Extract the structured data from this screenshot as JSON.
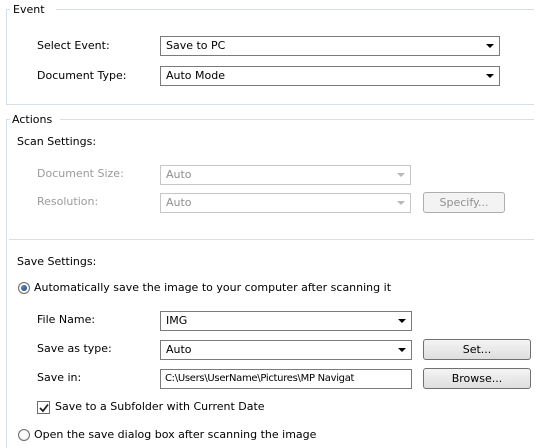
{
  "event": {
    "group_label": "Event",
    "select_event": {
      "label": "Select Event:",
      "value": "Save to PC"
    },
    "document_type": {
      "label": "Document Type:",
      "value": "Auto Mode"
    }
  },
  "actions": {
    "group_label": "Actions",
    "scan_settings": {
      "heading": "Scan Settings:",
      "document_size": {
        "label": "Document Size:",
        "value": "Auto"
      },
      "resolution": {
        "label": "Resolution:",
        "value": "Auto"
      },
      "specify_button": "Specify..."
    },
    "save_settings": {
      "heading": "Save Settings:",
      "auto_save_option": {
        "label": "Automatically save the image to your computer after scanning it",
        "selected": true
      },
      "file_name": {
        "label": "File Name:",
        "value": "IMG"
      },
      "save_as_type": {
        "label": "Save as type:",
        "value": "Auto"
      },
      "set_button": "Set...",
      "save_in": {
        "label": "Save in:",
        "value": "C:\\Users\\UserName\\Pictures\\MP Navigat"
      },
      "browse_button": "Browse...",
      "subfolder_checkbox": {
        "label": "Save to a Subfolder with Current Date",
        "checked": true
      },
      "open_dialog_option": {
        "label": "Open the save dialog box after scanning the image",
        "selected": false
      }
    }
  }
}
